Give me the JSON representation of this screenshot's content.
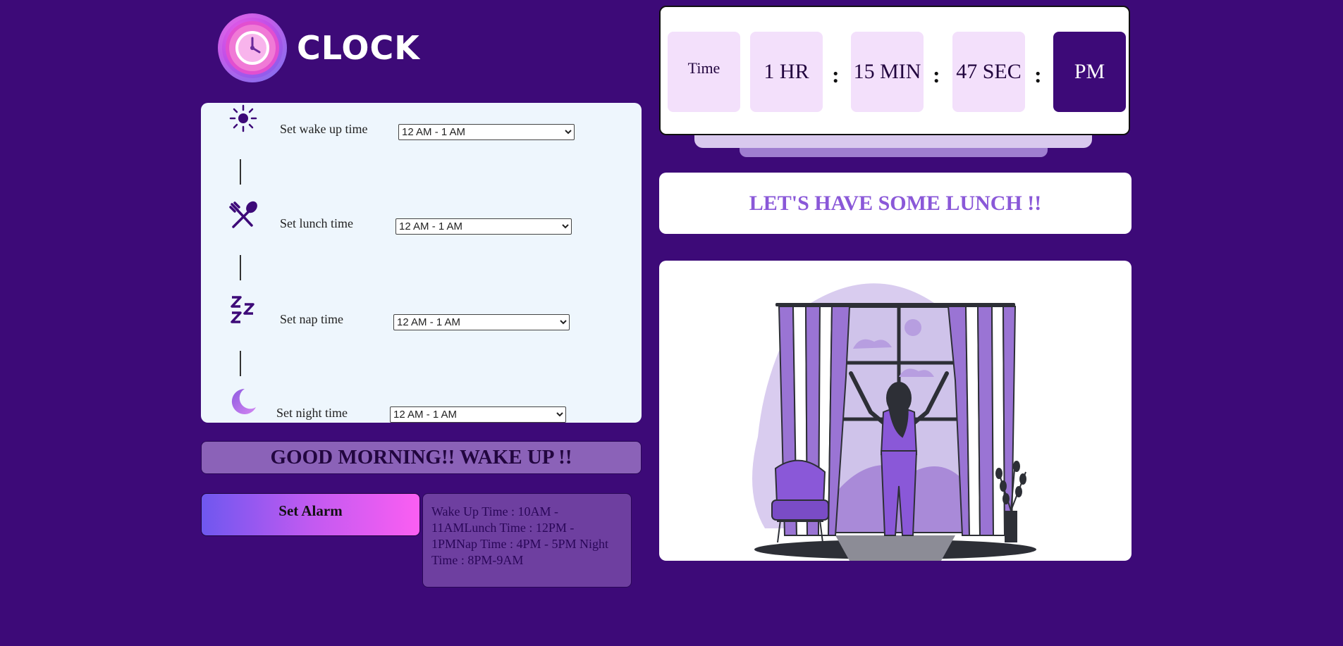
{
  "app": {
    "title": "CLOCK"
  },
  "schedule": {
    "items": [
      {
        "icon": "sun-icon",
        "label": "Set wake up time",
        "value": "12 AM - 1 AM"
      },
      {
        "icon": "fork-spoon-icon",
        "label": "Set lunch time",
        "value": "12 AM - 1 AM"
      },
      {
        "icon": "zzz-sleep-icon",
        "label": "Set nap time",
        "value": "12 AM - 1 AM"
      },
      {
        "icon": "moon-icon",
        "label": "Set night time",
        "value": "12 AM - 1 AM"
      }
    ]
  },
  "greeting": "GOOD MORNING!! WAKE UP !!",
  "alarm_button": "Set Alarm",
  "summary_text": "Wake Up Time : 10AM - 11AMLunch Time : 12PM - 1PMNap Time : 4PM - 5PM Night Time : 8PM-9AM",
  "clock": {
    "label": "Time",
    "hours": "1 HR",
    "minutes": "15 MIN",
    "seconds": "47 SEC",
    "ampm": "PM",
    "separator": ":"
  },
  "message": "LET'S HAVE SOME LUNCH !!",
  "colors": {
    "background": "#3d0a78",
    "accent": "#8a58d8",
    "panel": "#eef6fd"
  }
}
